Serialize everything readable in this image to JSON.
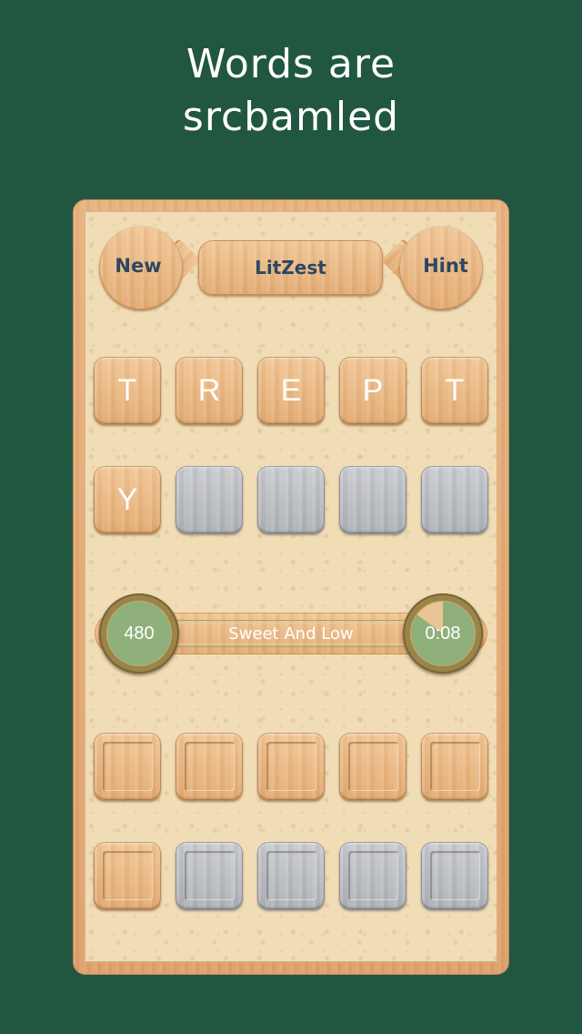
{
  "headline": {
    "line1": "Words are",
    "line2": "srcbamled"
  },
  "toolbar": {
    "new_label": "New",
    "title": "LitZest",
    "hint_label": "Hint"
  },
  "scrambled_letters": {
    "row1": [
      "T",
      "R",
      "E",
      "P",
      "T"
    ],
    "row2": [
      "Y",
      "",
      "",
      "",
      ""
    ],
    "row2_states": [
      "active",
      "inactive",
      "inactive",
      "inactive",
      "inactive"
    ]
  },
  "status": {
    "score": "480",
    "clue": "Sweet And Low",
    "timer": "0:08",
    "timer_remaining_fraction": 0.15
  },
  "answer_slots": {
    "row1": [
      "",
      "",
      "",
      "",
      ""
    ],
    "row2": [
      "",
      "",
      "",
      "",
      ""
    ],
    "row2_states": [
      "active",
      "inactive",
      "inactive",
      "inactive",
      "inactive"
    ]
  },
  "colors": {
    "background": "#215641",
    "text_title": "#2d4763",
    "ring_green": "#8fb07a",
    "ring_gold": "#9a8449"
  }
}
